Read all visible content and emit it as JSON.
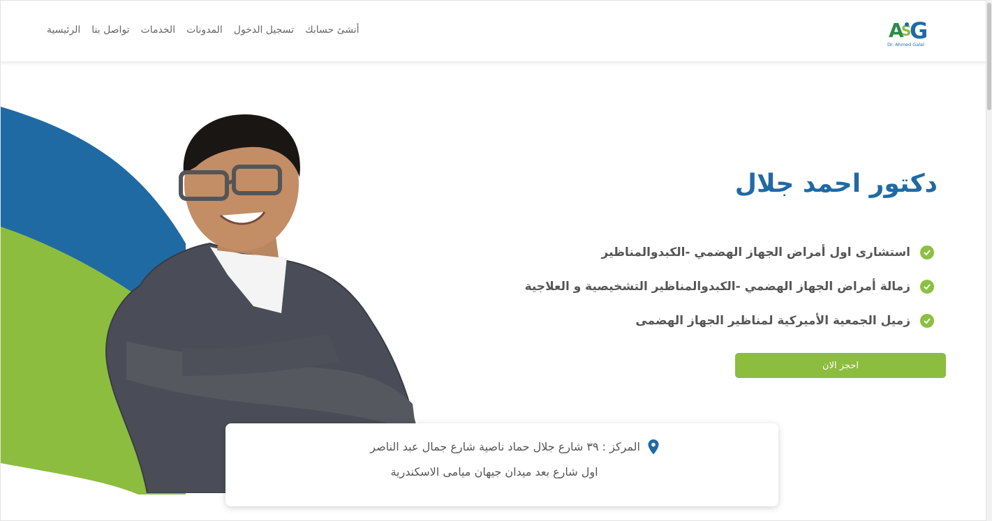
{
  "nav": {
    "items": [
      {
        "label": "الرئيسية"
      },
      {
        "label": "تواصل بنا"
      },
      {
        "label": "الخدمات"
      },
      {
        "label": "المدونات"
      },
      {
        "label": "تسجيل الدخول"
      },
      {
        "label": "أنشئ حسابك"
      }
    ],
    "logo_text": "Dr. Ahmed Galal",
    "logo_mark": "ASG"
  },
  "hero": {
    "title": "دكتور احمد جلال",
    "features": [
      "استشارى اول أمراض الجهاز الهضمي -الكبدوالمناظير",
      "زمالة أمراض الجهاز الهضمي -الكبدوالمناظير التشخيصية و العلاجية",
      "زميل الجمعية الأميركية لمناظير الجهاز الهضمى"
    ],
    "book_button": "احجز الان"
  },
  "address": {
    "line1": "المركز : ٣٩ شارع جلال حماد ناصية شارع جمال عبد الناصر",
    "line2": "اول شارع بعد ميدان جيهان ميامى الاسكندرية"
  },
  "icons": {
    "check": "check-circle-icon",
    "pin": "map-pin-icon"
  },
  "colors": {
    "brand_blue": "#1f6aa3",
    "brand_green": "#8cbd3f"
  }
}
